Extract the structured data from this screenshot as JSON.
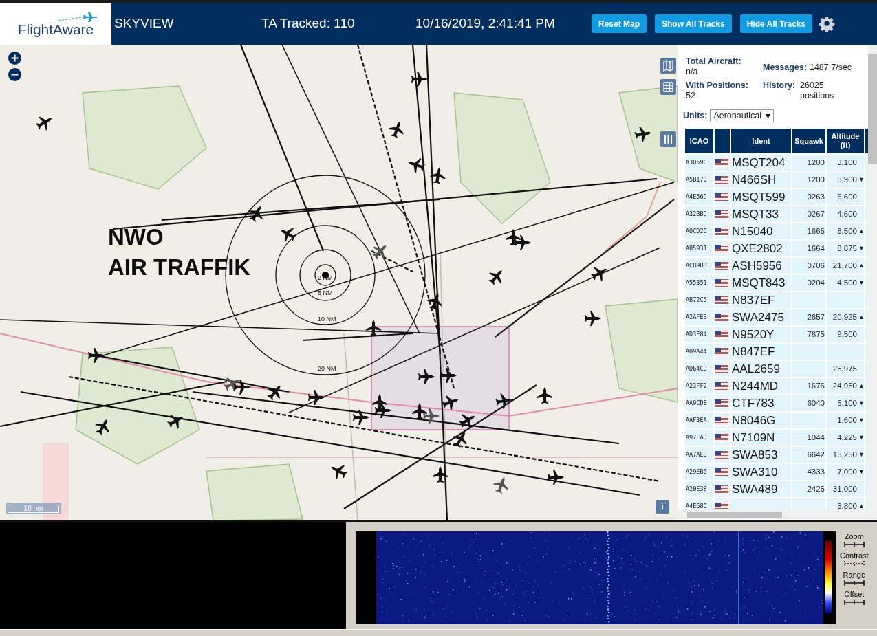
{
  "header": {
    "logo_text": "FlightAware",
    "title": "SKYVIEW",
    "tracked": "TA Tracked: 110",
    "datetime": "10/16/2019, 2:41:41 PM",
    "buttons": [
      "Reset Map",
      "Show All Tracks",
      "Hide All Tracks"
    ]
  },
  "map": {
    "overlay_lines": [
      "NWO",
      "AIR TRAFFIK"
    ],
    "range_rings": [
      "2 NM",
      "5 NM",
      "10 NM",
      "20 NM"
    ],
    "scale": "10 nm",
    "info_button": "i"
  },
  "stats": {
    "total_aircraft": {
      "label": "Total Aircraft:",
      "value": "n/a"
    },
    "with_positions": {
      "label": "With Positions:",
      "value": "52"
    },
    "messages": {
      "label": "Messages:",
      "value": "1487.7/sec"
    },
    "history": {
      "label": "History:",
      "value": "26025 positions"
    }
  },
  "units": {
    "label": "Units:",
    "value": "Aeronautical"
  },
  "table": {
    "columns": [
      "ICAO",
      "Ident",
      "Squawk",
      "Altitude (ft)"
    ],
    "rows": [
      {
        "icao": "A3059C",
        "ident": "MSQT204",
        "squawk": "1200",
        "altitude": "3,100",
        "trend": ""
      },
      {
        "icao": "A5B17D",
        "ident": "N466SH",
        "squawk": "1200",
        "altitude": "5,900",
        "trend": "▼"
      },
      {
        "icao": "A4E569",
        "ident": "MSQT599",
        "squawk": "0263",
        "altitude": "6,600",
        "trend": ""
      },
      {
        "icao": "A32BBD",
        "ident": "MSQT33",
        "squawk": "0267",
        "altitude": "4,600",
        "trend": ""
      },
      {
        "icao": "A0CD2C",
        "ident": "N15040",
        "squawk": "1665",
        "altitude": "8,500",
        "trend": "▲"
      },
      {
        "icao": "A85931",
        "ident": "QXE2802",
        "squawk": "1664",
        "altitude": "8,875",
        "trend": "▼"
      },
      {
        "icao": "AC89B3",
        "ident": "ASH5956",
        "squawk": "0706",
        "altitude": "21,700",
        "trend": "▲"
      },
      {
        "icao": "A55351",
        "ident": "MSQT843",
        "squawk": "0204",
        "altitude": "4,500",
        "trend": "▼"
      },
      {
        "icao": "AB72C5",
        "ident": "N837EF",
        "squawk": "",
        "altitude": "",
        "trend": ""
      },
      {
        "icao": "A2AFEB",
        "ident": "SWA2475",
        "squawk": "2657",
        "altitude": "20,925",
        "trend": "▲"
      },
      {
        "icao": "AD3E84",
        "ident": "N9520Y",
        "squawk": "7675",
        "altitude": "9,500",
        "trend": ""
      },
      {
        "icao": "AB9A44",
        "ident": "N847EF",
        "squawk": "",
        "altitude": "",
        "trend": ""
      },
      {
        "icao": "AD64CD",
        "ident": "AAL2659",
        "squawk": "",
        "altitude": "25,975",
        "trend": ""
      },
      {
        "icao": "A23FF2",
        "ident": "N244MD",
        "squawk": "1676",
        "altitude": "24,950",
        "trend": "▲"
      },
      {
        "icao": "AA9CDE",
        "ident": "CTF783",
        "squawk": "6040",
        "altitude": "5,100",
        "trend": "▼"
      },
      {
        "icao": "AAF3EA",
        "ident": "N8046G",
        "squawk": "",
        "altitude": "1,600",
        "trend": "▼"
      },
      {
        "icao": "A97FAD",
        "ident": "N7109N",
        "squawk": "1044",
        "altitude": "4,225",
        "trend": "▼"
      },
      {
        "icao": "AA7AEB",
        "ident": "SWA853",
        "squawk": "6642",
        "altitude": "15,250",
        "trend": "▼"
      },
      {
        "icao": "A29EB6",
        "ident": "SWA310",
        "squawk": "4333",
        "altitude": "7,000",
        "trend": "▼"
      },
      {
        "icao": "A20E38",
        "ident": "SWA489",
        "squawk": "2425",
        "altitude": "31,000",
        "trend": ""
      },
      {
        "icao": "A4E68C",
        "ident": "",
        "squawk": "",
        "altitude": "3,800",
        "trend": "▲"
      }
    ]
  },
  "spectrum": {
    "controls": [
      "Zoom",
      "Contrast",
      "Range",
      "Offset"
    ]
  }
}
